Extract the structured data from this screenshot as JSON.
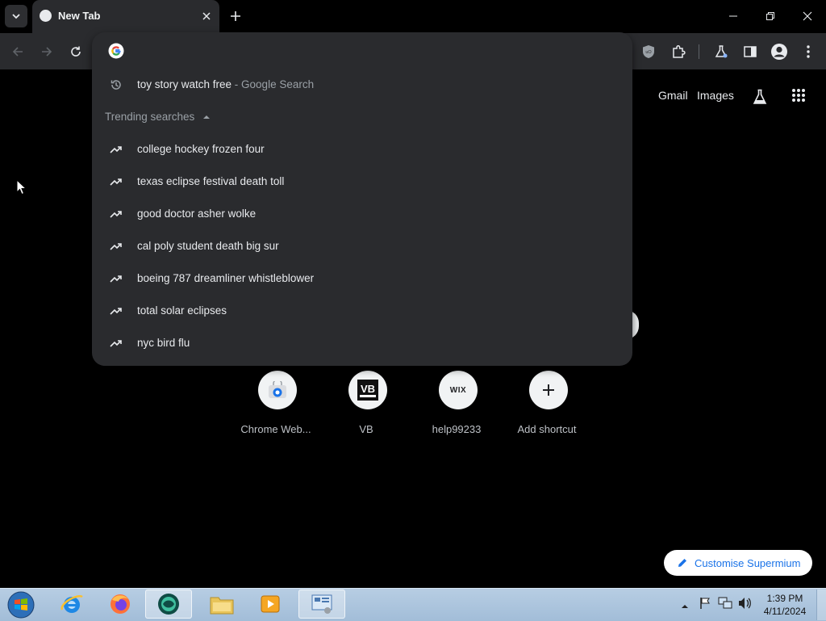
{
  "browser": {
    "tab_title": "New Tab",
    "omnibox_value": "",
    "header_links": [
      "Gmail",
      "Images"
    ]
  },
  "suggestions": {
    "history_item": {
      "query": "toy story watch free",
      "suffix": " - Google Search"
    },
    "trending_header": "Trending searches",
    "trending": [
      "college hockey frozen four",
      "texas eclipse festival death toll",
      "good doctor asher wolke",
      "cal poly student death big sur",
      "boeing 787 dreamliner whistleblower",
      "total solar eclipses",
      "nyc bird flu"
    ]
  },
  "shortcuts": [
    {
      "label": "Chrome Web...",
      "icon": "chrome-web-store-icon"
    },
    {
      "label": "VB",
      "icon": "vb-logo-icon"
    },
    {
      "label": "help99233",
      "icon": "wix-logo-icon",
      "icon_text": "WIX"
    },
    {
      "label": "Add shortcut",
      "icon": "plus-icon"
    }
  ],
  "customise_label": "Customise Supermium",
  "taskbar": {
    "time": "1:39 PM",
    "date": "4/11/2024"
  },
  "colors": {
    "accent": "#1a73e8",
    "dropdown_bg": "#2a2b2e",
    "page_bg": "#000000"
  }
}
